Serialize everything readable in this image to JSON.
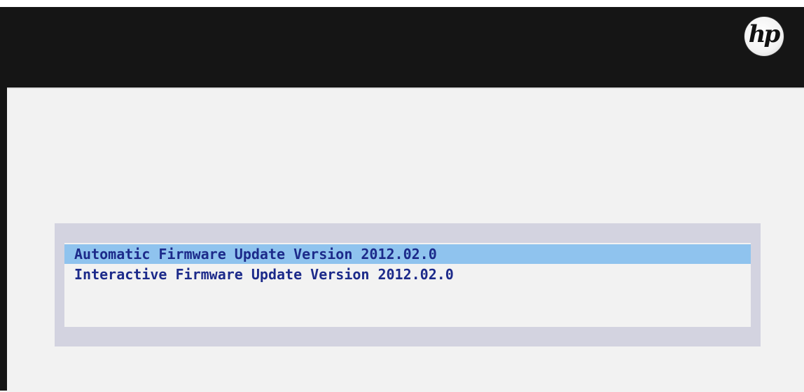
{
  "header": {
    "logo_text": "hp",
    "logo_icon": "hp-logo"
  },
  "menu": {
    "items": [
      {
        "label": "Automatic Firmware Update Version 2012.02.0",
        "selected": true
      },
      {
        "label": "Interactive Firmware Update Version 2012.02.0",
        "selected": false
      }
    ]
  },
  "colors": {
    "background": "#151515",
    "panel": "#f2f2f2",
    "menu_frame": "#d3d3e0",
    "selection_highlight": "#8fc3ee",
    "menu_text": "#1c2a8a"
  }
}
